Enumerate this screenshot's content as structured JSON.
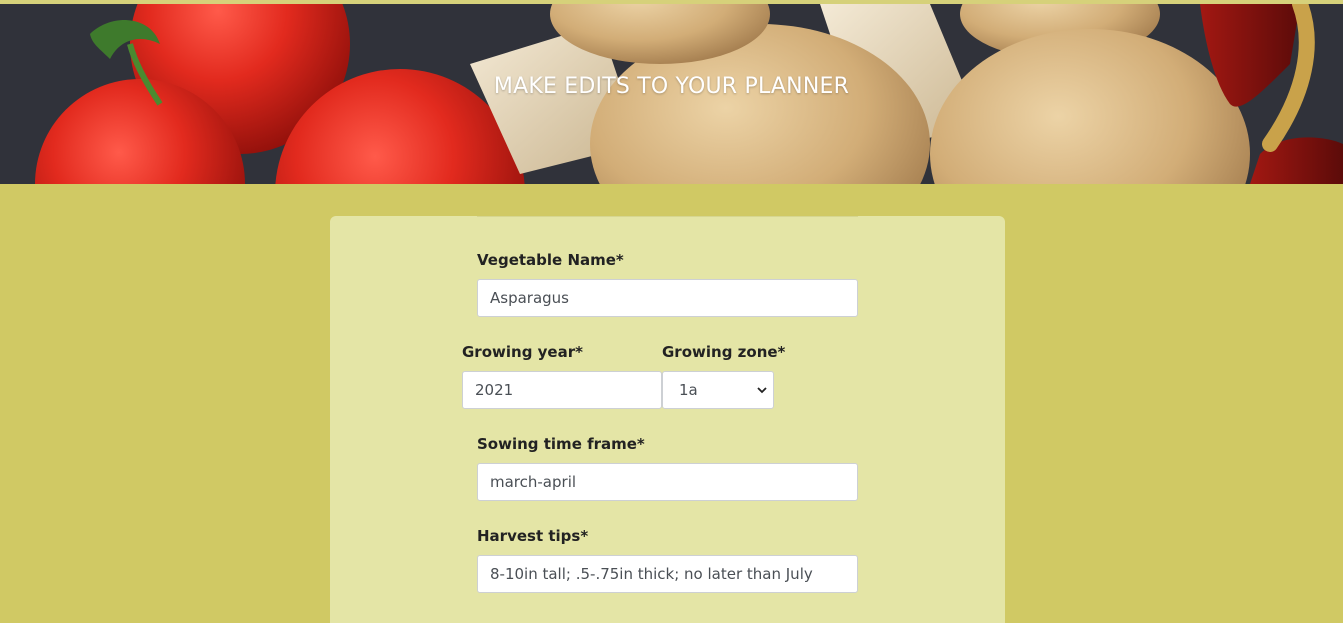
{
  "hero": {
    "title": "MAKE EDITS TO YOUR PLANNER",
    "image": "vegetables-banner-image"
  },
  "form": {
    "vegetable_name": {
      "label": "Vegetable Name*",
      "value": "Asparagus"
    },
    "growing_year": {
      "label": "Growing year*",
      "value": "2021"
    },
    "growing_zone": {
      "label": "Growing zone*",
      "selected": "1a"
    },
    "sowing_time_frame": {
      "label": "Sowing time frame*",
      "value": "march-april"
    },
    "harvest_tips": {
      "label": "Harvest tips*",
      "value": "8-10in tall; .5-.75in thick; no later than July"
    }
  },
  "colors": {
    "page_background": "#d0c964",
    "card_background": "#e4e5a6",
    "title_text": "#ffffff"
  }
}
